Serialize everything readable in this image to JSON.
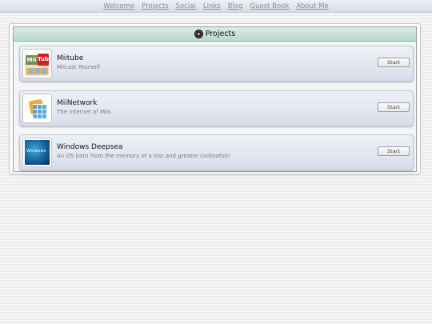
{
  "nav": {
    "links": [
      "Welcome",
      "Projects",
      "Social",
      "Links",
      "Blog",
      "Guest Book",
      "About Me"
    ]
  },
  "panel": {
    "title": "Projects",
    "title_icon": "disc-icon"
  },
  "projects": [
    {
      "name": "Miitube",
      "description": "Miicast Yourself",
      "button": "Start",
      "icon": "miitube-thumbnail",
      "thumb_text": [
        "Mii",
        "Tub"
      ]
    },
    {
      "name": "MiiNetwork",
      "description": "The internet of Miis",
      "button": "Start",
      "icon": "miinetwork-thumbnail"
    },
    {
      "name": "Windows Deepsea",
      "description": "An OS born from the memory of a lost and greater civilization",
      "button": "Start",
      "icon": "windows-deepsea-thumbnail",
      "thumb_text": "Windows"
    }
  ],
  "colors": {
    "title_bar": "#c8e2da",
    "item_bg": "#e3e6f1",
    "nav_link": "#8a8f99"
  }
}
